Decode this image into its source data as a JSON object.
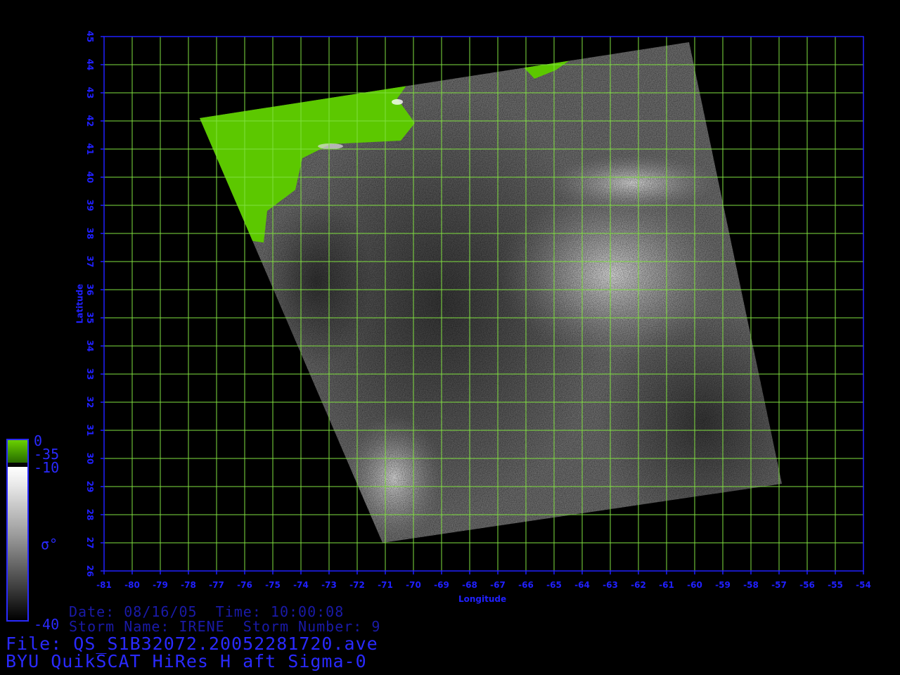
{
  "map": {
    "lon_range": [
      -81,
      -54
    ],
    "lat_range": [
      26,
      45
    ],
    "lon_ticks": [
      "-81",
      "-80",
      "-79",
      "-78",
      "-77",
      "-76",
      "-75",
      "-74",
      "-73",
      "-72",
      "-71",
      "-70",
      "-69",
      "-68",
      "-67",
      "-66",
      "-65",
      "-64",
      "-63",
      "-62",
      "-61",
      "-60",
      "-59",
      "-58",
      "-57",
      "-56",
      "-55",
      "-54"
    ],
    "lat_ticks": [
      "26",
      "27",
      "28",
      "29",
      "30",
      "31",
      "32",
      "33",
      "34",
      "35",
      "36",
      "37",
      "38",
      "39",
      "40",
      "41",
      "42",
      "43",
      "44",
      "45"
    ],
    "xlabel": "Longitude",
    "ylabel": "Latitude",
    "grid": true,
    "grid_color": "#80e040",
    "axis_color": "#2020ff",
    "land_color": "#5cc800",
    "swath_corners_lonlat": [
      [
        -77.6,
        42.1
      ],
      [
        -60.2,
        44.8
      ],
      [
        -56.9,
        29.1
      ],
      [
        -71.1,
        27.0
      ]
    ]
  },
  "colorbar": {
    "top_label": "0",
    "mid_label_1": "-35",
    "mid_label_2": "-10",
    "bottom_label": "-40",
    "symbol": "σ°",
    "colors": [
      "#5cc800",
      "#000000",
      "#ffffff",
      "#000000"
    ]
  },
  "info": {
    "date_line": "Date: 08/16/05  Time: 10:00:08",
    "storm_line": "Storm Name: IRENE  Storm Number: 9",
    "file_line": "File: QS_S1B32072.20052281720.ave",
    "product_line": "BYU QuikSCAT HiRes H aft Sigma-0"
  }
}
